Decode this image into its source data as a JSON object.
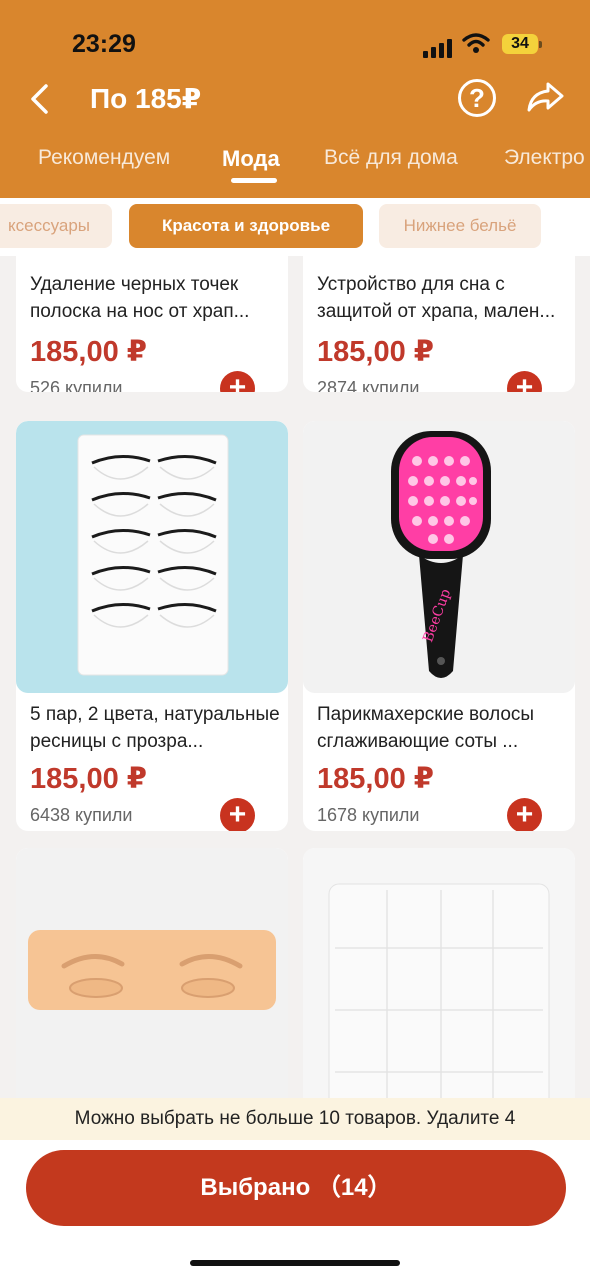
{
  "status_bar": {
    "time": "23:29",
    "battery": "34"
  },
  "header": {
    "title": "По 185₽",
    "back_icon": "chevron-left-icon",
    "help_label": "?",
    "share_icon": "share-arrow-icon"
  },
  "tabs": [
    {
      "label": "Рекомендуем"
    },
    {
      "label": "Мода"
    },
    {
      "label": "Всё для дома"
    },
    {
      "label": "Электро"
    }
  ],
  "chips": [
    {
      "label": "ксессуары"
    },
    {
      "label": "Красота и здоровье"
    },
    {
      "label": "Нижнее бельё"
    }
  ],
  "products": [
    {
      "name": "Удаление черных точек полоска на нос от храп...",
      "price": "185,00 ₽",
      "sold": "526 купили"
    },
    {
      "name": "Устройство для сна с защитой от храпа, мален...",
      "price": "185,00 ₽",
      "sold": "2874 купили"
    },
    {
      "name": "5 пар, 2 цвета, натуральные ресницы с прозра...",
      "price": "185,00 ₽",
      "sold": "6438 купили"
    },
    {
      "name": "Парикмахерские волосы сглаживающие соты ...",
      "price": "185,00 ₽",
      "sold": "1678 купили"
    },
    {
      "name": "",
      "price": "",
      "sold": ""
    },
    {
      "name": "",
      "price": "",
      "sold": ""
    }
  ],
  "product_images": {
    "brush_logo": "BeeCup"
  },
  "add_button_label": "+",
  "notice": "Можно выбрать не больше 10 товаров. Удалите 4",
  "select_button": {
    "label": "Выбрано （14）"
  }
}
